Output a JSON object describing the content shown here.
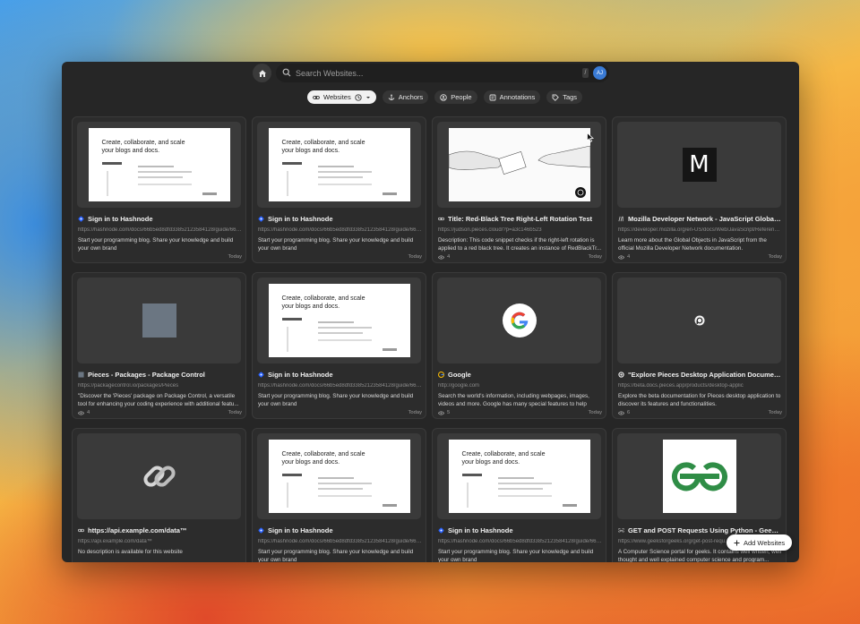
{
  "search": {
    "placeholder": "Search Websites...",
    "shortcut": "/",
    "avatar": "AJ"
  },
  "filters": [
    {
      "label": "Websites",
      "active": true
    },
    {
      "label": "Anchors",
      "active": false
    },
    {
      "label": "People",
      "active": false
    },
    {
      "label": "Annotations",
      "active": false
    },
    {
      "label": "Tags",
      "active": false
    }
  ],
  "hashnode_thumb_text": "Create, collaborate, and scale your blogs and docs.",
  "mdn_logo_text": "M",
  "cards": [
    {
      "thumb": "hashnode",
      "icon": "hashnode-icon",
      "title": "Sign in to Hashnode",
      "url": "https://hashnode.com/docs/66b5ed8dfd33852123584128/guide/66b...",
      "desc": "Start your programming blog. Share your knowledge and build your own brand",
      "views": "",
      "date": "Today"
    },
    {
      "thumb": "hashnode",
      "icon": "hashnode-icon",
      "title": "Sign in to Hashnode",
      "url": "https://hashnode.com/docs/66b5ed8dfd33852123584128/guide/66b...",
      "desc": "Start your programming blog. Share your knowledge and build your own brand",
      "views": "",
      "date": "Today"
    },
    {
      "thumb": "redblack",
      "icon": "link-icon",
      "title": "Title: Red-Black Tree Right-Left Rotation Test",
      "url": "https://judson.pieces.cloud/?p=a3c146b523",
      "desc": "Description: This code snippet checks if the right-left rotation is applied to a red black tree. It creates an instance of RedBlackTr...",
      "views": "4",
      "date": "Today"
    },
    {
      "thumb": "mdn",
      "icon": "mdn-icon",
      "title": "Mozilla Developer Network - JavaScript Global Obj...",
      "url": "https://developer.mozilla.org/en-US/docs/Web/JavaScript/Reference/...",
      "desc": "Learn more about the Global Objects in JavaScript from the official Mozilla Developer Network documentation.",
      "views": "4",
      "date": "Today"
    },
    {
      "thumb": "gray",
      "icon": "package-icon",
      "title": "Pieces - Packages - Package Control",
      "url": "https://packagecontrol.io/packages/Pieces",
      "desc": "\"Discover the 'Pieces' package on Package Control, a versatile tool for enhancing your coding experience with additional featu...",
      "views": "4",
      "date": "Today"
    },
    {
      "thumb": "hashnode",
      "icon": "hashnode-icon",
      "title": "Sign in to Hashnode",
      "url": "https://hashnode.com/docs/66b5ed8dfd33852123584128/guide/66b...",
      "desc": "Start your programming blog. Share your knowledge and build your own brand",
      "views": "",
      "date": "Today"
    },
    {
      "thumb": "google",
      "icon": "google-icon",
      "title": "Google",
      "url": "http://google.com",
      "desc": "Search the world's information, including webpages, images, videos and more. Google has many special features to help you...",
      "views": "5",
      "date": "Today"
    },
    {
      "thumb": "pieces",
      "icon": "pieces-icon",
      "title": "\"Explore Pieces Desktop Application Documentati...",
      "url": "https://beta.docs.pieces.app/products/desktop-applic",
      "desc": "Explore the beta documentation for Pieces desktop application to discover its features and functionalities.",
      "views": "6",
      "date": "Today"
    },
    {
      "thumb": "chain",
      "icon": "link-icon",
      "title": "https://api.example.com/data™",
      "url": "https://api.example.com/data™",
      "desc": "No description is available for this website",
      "views": "",
      "date": ""
    },
    {
      "thumb": "hashnode",
      "icon": "hashnode-icon",
      "title": "Sign in to Hashnode",
      "url": "https://hashnode.com/docs/66b5ed8dfd33852123584128/guide/66b...",
      "desc": "Start your programming blog. Share your knowledge and build your own brand",
      "views": "",
      "date": ""
    },
    {
      "thumb": "hashnode",
      "icon": "hashnode-icon",
      "title": "Sign in to Hashnode",
      "url": "https://hashnode.com/docs/66b5ed8dfd33852123584128/guide/66b...",
      "desc": "Start your programming blog. Share your knowledge and build your own brand",
      "views": "",
      "date": ""
    },
    {
      "thumb": "gfg",
      "icon": "geeksforgeeks-icon",
      "title": "GET and POST Requests Using Python - Geeksfor...",
      "url": "https://www.geeksforgeeks.org/get-post-requ...",
      "desc": "A Computer Science portal for geeks. It contains well written, well thought and well explained computer science and program...",
      "views": "",
      "date": ""
    }
  ],
  "add_button": {
    "label": "Add Websites"
  },
  "colors": {
    "window": "#262626",
    "card": "#2c2c2c",
    "hashnode_blue": "#2962ff",
    "gfg_green": "#2f8d46"
  }
}
